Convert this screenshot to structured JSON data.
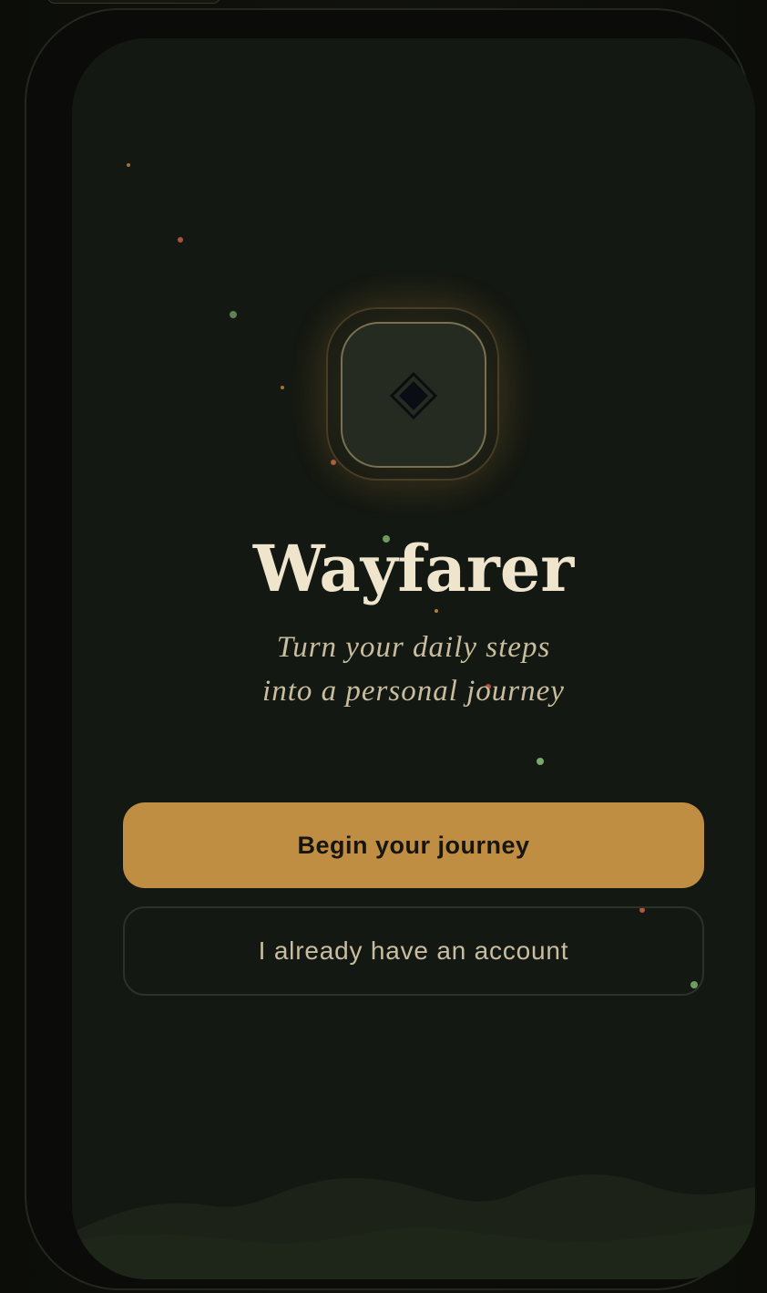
{
  "app": {
    "name": "Wayfarer",
    "tagline_line1": "Turn your daily steps",
    "tagline_line2": "into a personal journey"
  },
  "actions": {
    "primary_label": "Begin your journey",
    "secondary_label": "I already have an account"
  },
  "icons": {
    "logo": "diamond-icon"
  },
  "colors": {
    "background": "#141812",
    "accent": "#c08e42",
    "title": "#efe5cc",
    "tagline": "#c8bd9f"
  }
}
